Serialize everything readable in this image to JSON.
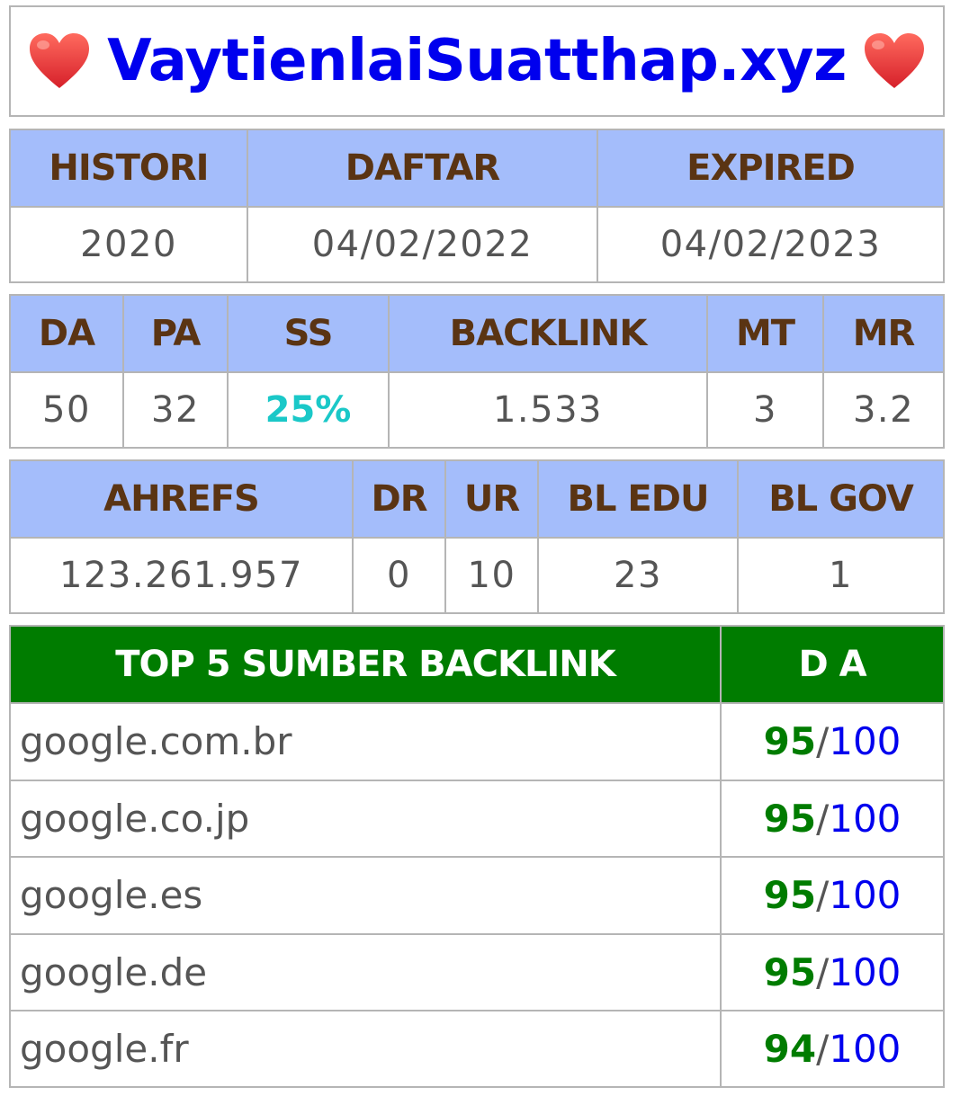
{
  "header": {
    "domain": "VaytienlaiSuatthap.xyz"
  },
  "dates": {
    "headers": [
      "HISTORI",
      "DAFTAR",
      "EXPIRED"
    ],
    "values": [
      "2020",
      "04/02/2022",
      "04/02/2023"
    ]
  },
  "metrics": {
    "headers": [
      "DA",
      "PA",
      "SS",
      "BACKLINK",
      "MT",
      "MR"
    ],
    "values": [
      "50",
      "32",
      "25%",
      "1.533",
      "3",
      "3.2"
    ]
  },
  "ahrefs": {
    "headers": [
      "AHREFS",
      "DR",
      "UR",
      "BL EDU",
      "BL GOV"
    ],
    "values": [
      "123.261.957",
      "0",
      "10",
      "23",
      "1"
    ]
  },
  "top_backlinks": {
    "headers": [
      "TOP 5 SUMBER BACKLINK",
      "D A"
    ],
    "rows": [
      {
        "site": "google.com.br",
        "score": "95",
        "sep": "/",
        "max": "100"
      },
      {
        "site": "google.co.jp",
        "score": "95",
        "sep": "/",
        "max": "100"
      },
      {
        "site": "google.es",
        "score": "95",
        "sep": "/",
        "max": "100"
      },
      {
        "site": "google.de",
        "score": "95",
        "sep": "/",
        "max": "100"
      },
      {
        "site": "google.fr",
        "score": "94",
        "sep": "/",
        "max": "100"
      }
    ]
  },
  "colors": {
    "header_bg": "#a4bdfb",
    "header_text": "#5a3413",
    "top_header_bg": "#007c00",
    "link_blue": "#0000ee",
    "ss_cyan": "#1ac8c8",
    "heart_red": "#e8403a"
  }
}
